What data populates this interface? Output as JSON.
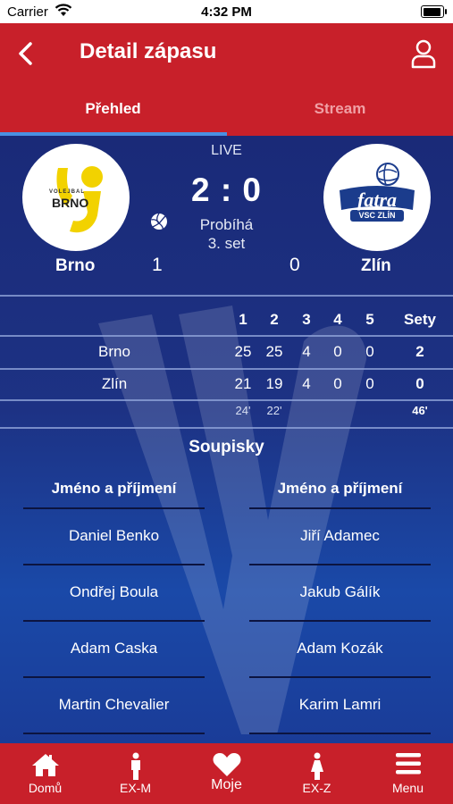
{
  "status_bar": {
    "carrier": "Carrier",
    "time": "4:32 PM"
  },
  "header": {
    "title": "Detail zápasu"
  },
  "tabs": [
    {
      "label": "Přehled",
      "active": true
    },
    {
      "label": "Stream",
      "active": false
    }
  ],
  "match": {
    "live_label": "LIVE",
    "score": "2 : 0",
    "status": "Probíhá",
    "current_set": "3. set",
    "home": {
      "name": "Brno",
      "sets_won": "1",
      "logo_text": "BRNO",
      "logo_subtext": "VOLEJBAL"
    },
    "away": {
      "name": "Zlín",
      "sets_won": "0",
      "logo_text": "fatra",
      "logo_subtext": "VSC ZLÍN"
    }
  },
  "sets_table": {
    "headers": [
      "1",
      "2",
      "3",
      "4",
      "5"
    ],
    "total_header": "Sety",
    "rows": [
      {
        "team": "Brno",
        "scores": [
          "25",
          "25",
          "4",
          "0",
          "0"
        ],
        "total": "2"
      },
      {
        "team": "Zlín",
        "scores": [
          "21",
          "19",
          "4",
          "0",
          "0"
        ],
        "total": "0"
      }
    ],
    "durations": [
      "24'",
      "22'"
    ],
    "total_duration": "46'"
  },
  "rosters": {
    "title": "Soupisky",
    "column_header": "Jméno a příjmení",
    "home": [
      "Daniel Benko",
      "Ondřej Boula",
      "Adam Caska",
      "Martin Chevalier"
    ],
    "away": [
      "Jiří Adamec",
      "Jakub Gálík",
      "Adam Kozák",
      "Karim Lamri"
    ]
  },
  "tabbar": [
    {
      "label": "Domů",
      "icon": "home-icon"
    },
    {
      "label": "EX-M",
      "icon": "male-icon"
    },
    {
      "label": "Moje",
      "icon": "heart-icon"
    },
    {
      "label": "EX-Z",
      "icon": "female-icon"
    },
    {
      "label": "Menu",
      "icon": "menu-icon"
    }
  ],
  "colors": {
    "brand_red": "#c8202a",
    "navy": "#1a2a78",
    "tab_indicator": "#4a90e2",
    "logo_yellow": "#f2d200",
    "logo_blue": "#1b3c8c"
  }
}
